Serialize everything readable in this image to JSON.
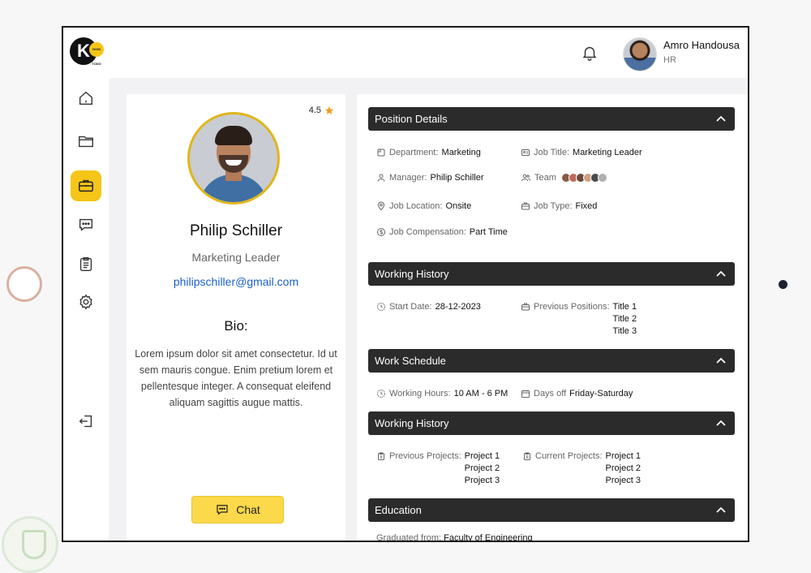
{
  "header": {
    "logo": {
      "letter": "K",
      "badge": "NOW TODO"
    },
    "notifications_icon": "bell-icon",
    "user": {
      "name": "Amro Handousa",
      "role": "HR"
    }
  },
  "sidebar": {
    "items": [
      {
        "icon": "home-icon"
      },
      {
        "icon": "folder-icon"
      },
      {
        "icon": "briefcase-icon",
        "active": true
      },
      {
        "icon": "chat-icon"
      },
      {
        "icon": "clipboard-icon"
      },
      {
        "icon": "gear-icon"
      }
    ],
    "logout_icon": "logout-icon"
  },
  "profile": {
    "rating": "4.5",
    "name": "Philip Schiller",
    "title": "Marketing Leader",
    "email": "philipschiller@gmail.com",
    "bio_heading": "Bio:",
    "bio": "Lorem ipsum dolor sit amet consectetur. Id ut sem mauris congue. Enim pretium lorem et pellentesque integer. A consequat eleifend aliquam sagittis augue mattis.",
    "chat_label": "Chat"
  },
  "position": {
    "heading": "Position Details",
    "department_label": "Department:",
    "department": "Marketing",
    "job_title_label": "Job Title:",
    "job_title": "Marketing Leader",
    "manager_label": "Manager:",
    "manager": "Philip Schiller",
    "team_label": "Team",
    "location_label": "Job Location:",
    "location": "Onsite",
    "job_type_label": "Job Type:",
    "job_type": "Fixed",
    "compensation_label": "Job Compensation:",
    "compensation": "Part Time"
  },
  "working_history": {
    "heading": "Working History",
    "start_label": "Start Date:",
    "start": "28-12-2023",
    "previous_label": "Previous Positions:",
    "previous": [
      "Title 1",
      "Title 2",
      "Title 3"
    ]
  },
  "schedule": {
    "heading": "Work Schedule",
    "hours_label": "Working Hours:",
    "hours": "10 AM - 6 PM",
    "days_label": "Days off",
    "days": "Friday-Saturday"
  },
  "projects": {
    "heading": "Working History",
    "previous_label": "Previous Projects:",
    "previous": [
      "Project 1",
      "Project 2",
      "Project 3"
    ],
    "current_label": "Current Projects:",
    "current": [
      "Project 1",
      "Project 2",
      "Project 3"
    ]
  },
  "education": {
    "heading": "Education",
    "first_label": "Graduated from:",
    "first_value": "Faculty of Engineering"
  },
  "colors": {
    "accent": "#f5c518",
    "section_header": "#2b2b2b",
    "link": "#1a5fc8"
  }
}
